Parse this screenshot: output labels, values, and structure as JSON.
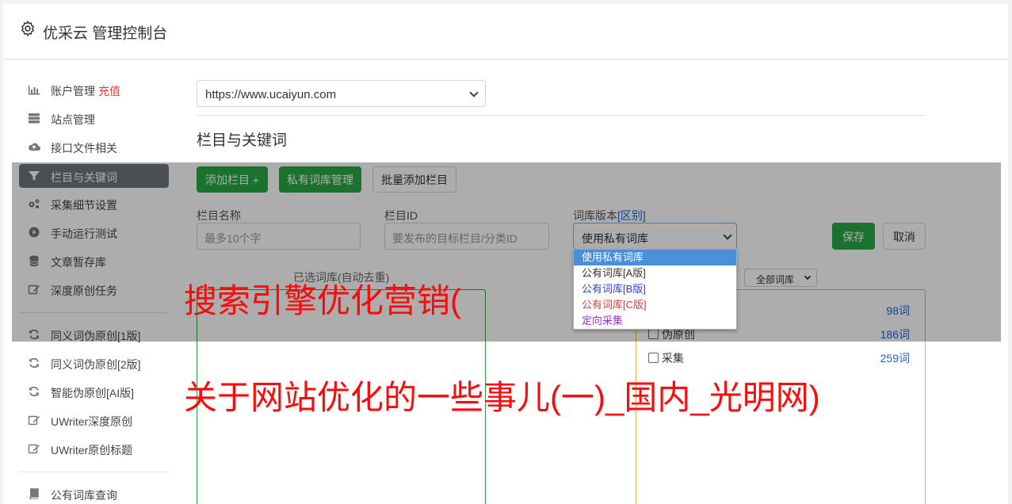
{
  "header": {
    "title": "优采云 管理控制台",
    "icon": "gear-icon"
  },
  "sidebar": {
    "items": [
      {
        "label": "账户管理",
        "badge": "充值",
        "icon": "bar-chart-icon"
      },
      {
        "label": "站点管理",
        "icon": "server-icon"
      },
      {
        "label": "接口文件相关",
        "icon": "cloud-upload-icon"
      },
      {
        "label": "栏目与关键词",
        "icon": "filter-icon",
        "active": true
      },
      {
        "label": "采集细节设置",
        "icon": "cogs-icon"
      },
      {
        "label": "手动运行测试",
        "icon": "play-circle-icon"
      },
      {
        "label": "文章暂存库",
        "icon": "database-icon"
      },
      {
        "label": "深度原创任务",
        "icon": "edit-icon"
      },
      {
        "label": "同义词伪原创[1版]",
        "icon": "refresh-icon"
      },
      {
        "label": "同义词伪原创[2版]",
        "icon": "refresh-icon"
      },
      {
        "label": "智能伪原创[AI版]",
        "icon": "refresh-icon"
      },
      {
        "label": "UWriter深度原创",
        "icon": "edit-icon"
      },
      {
        "label": "UWriter原创标题",
        "icon": "edit-icon"
      },
      {
        "label": "公有词库查询",
        "icon": "book-icon"
      }
    ]
  },
  "main": {
    "site_select": "https://www.ucaiyun.com",
    "section_title": "栏目与关键词",
    "buttons": {
      "add_column": "添加栏目 +",
      "private_lexicon": "私有词库管理",
      "batch_add": "批量添加栏目"
    },
    "form": {
      "column_name_label": "栏目名称",
      "column_name_placeholder": "最多10个字",
      "column_id_label": "栏目ID",
      "column_id_placeholder": "要发布的目标栏目/分类ID",
      "lexicon_version_label": "词库版本",
      "lexicon_version_link": "[区别]",
      "lexicon_version_value": "使用私有词库",
      "save": "保存",
      "cancel": "取消"
    },
    "lexicon_options": [
      {
        "label": "使用私有词库",
        "color": "#ffffff",
        "selected": true
      },
      {
        "label": "公有词库[A版]",
        "color": "#333333"
      },
      {
        "label": "公有词库[B版]",
        "color": "#2b3fd6"
      },
      {
        "label": "公有词库[C版]",
        "color": "#d33c3c"
      },
      {
        "label": "定向采集",
        "color": "#9b30c8"
      }
    ],
    "selected_words_hint": "已选词库(自动去重)",
    "lexicon_filter": "全部词库",
    "lexicon_list": [
      {
        "name": "",
        "count": "98词"
      },
      {
        "name": "伪原创",
        "count": "186词"
      },
      {
        "name": "采集",
        "count": "259词"
      }
    ]
  },
  "watermark": {
    "line1": "搜索引擎优化营销(",
    "line2": "关于网站优化的一些事儿(一)_国内_光明网)"
  },
  "colors": {
    "primary_green": "#28a745",
    "active_nav": "#6c757d",
    "link_blue": "#1e62d0",
    "watermark_red": "#ff0a0a"
  }
}
